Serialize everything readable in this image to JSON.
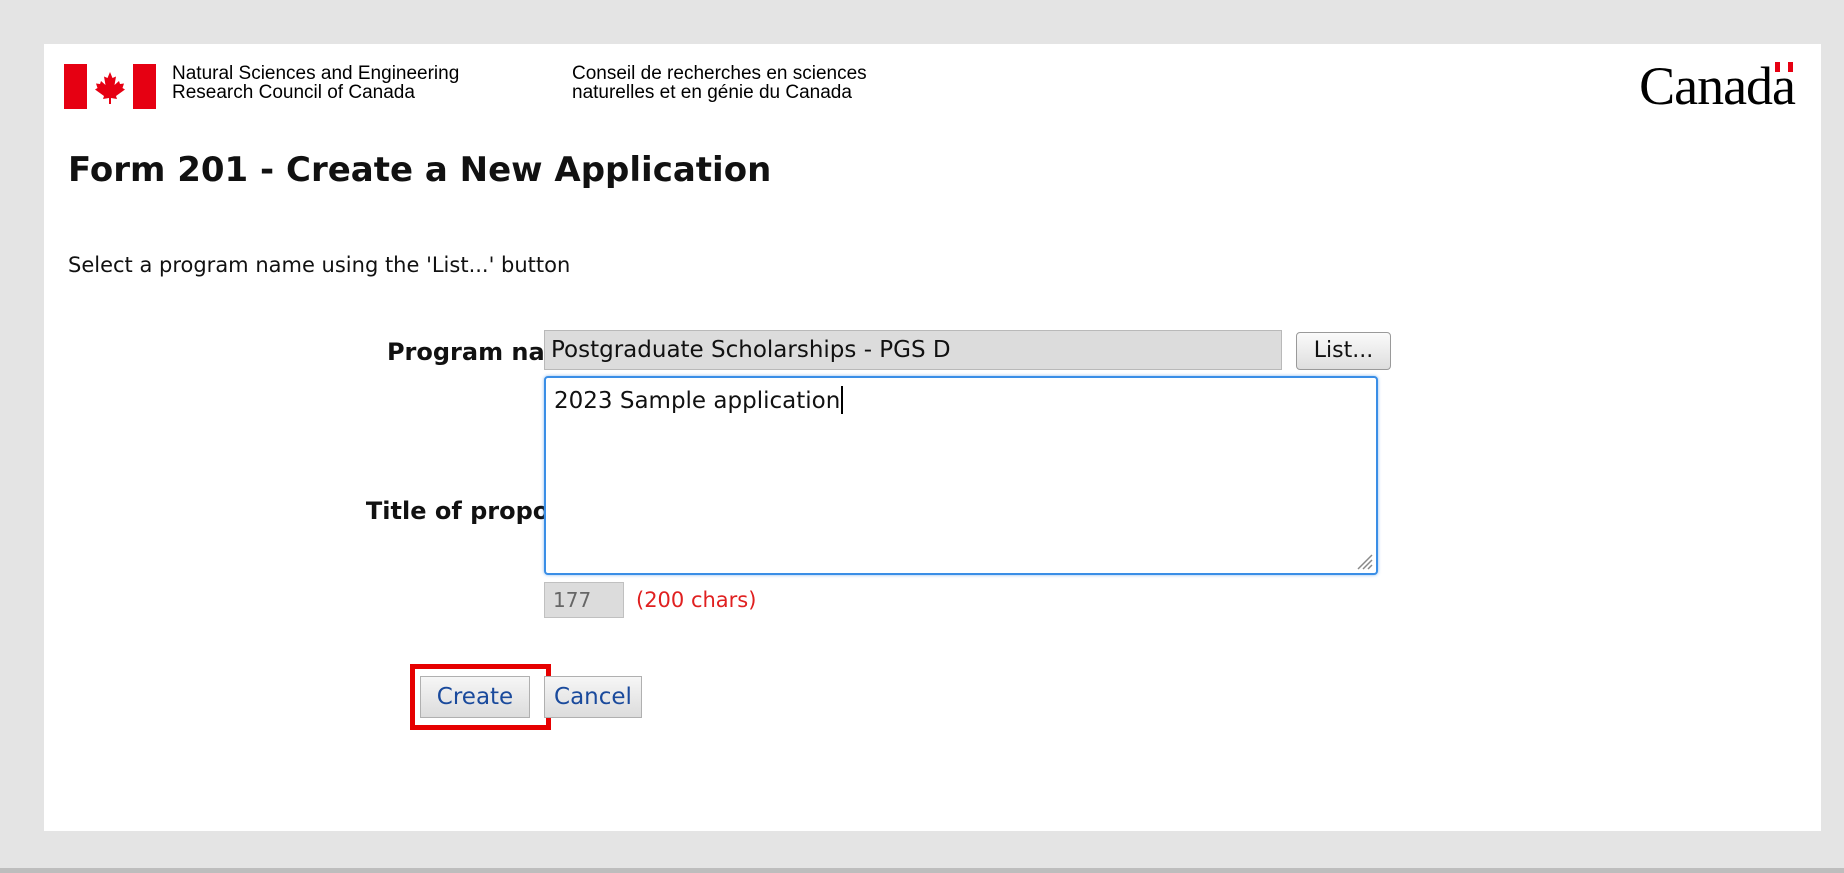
{
  "header": {
    "signature_en_line1": "Natural Sciences and Engineering",
    "signature_en_line2": "Research Council of Canada",
    "signature_fr_line1": "Conseil de recherches en sciences",
    "signature_fr_line2": "naturelles et en génie du Canada",
    "wordmark": "Canada",
    "flag_icon": "canada-flag-icon",
    "brand_red": "#e60012"
  },
  "form": {
    "title": "Form 201 - Create a New Application",
    "instructions": "Select a program name using the 'List...' button",
    "program_label": "Program name",
    "program_value": "Postgraduate Scholarships - PGS D",
    "list_button_label": "List...",
    "title_label": "Title of proposal",
    "title_value": "2023 Sample application",
    "remaining_chars": "177",
    "char_limit_text": "(200 chars)",
    "create_label": "Create",
    "cancel_label": "Cancel",
    "highlight_color": "#e60000",
    "focus_color": "#3a8ee6"
  }
}
